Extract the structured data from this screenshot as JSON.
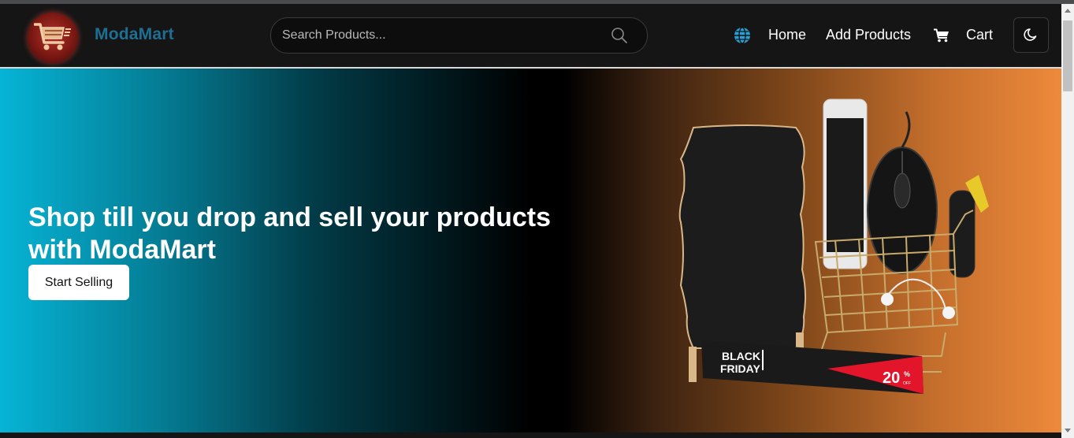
{
  "brand": {
    "name": "ModaMart",
    "logo_icon": "shopping-cart-logo-icon"
  },
  "search": {
    "placeholder": "Search Products...",
    "value": "",
    "icon": "search-icon"
  },
  "nav": {
    "globe_icon": "globe-icon",
    "links": [
      {
        "label": "Home"
      },
      {
        "label": "Add Products"
      },
      {
        "label": "Cart",
        "icon": "cart-icon"
      }
    ],
    "theme_toggle_icon": "moon-icon"
  },
  "hero": {
    "title": "Shop till you drop and sell your products with ModaMart",
    "cta_label": "Start Selling",
    "image": {
      "label_black_friday_line1": "BLACK",
      "label_black_friday_line2": "FRIDAY",
      "discount": "20",
      "discount_unit": "%",
      "discount_suffix": "OFF"
    }
  },
  "colors": {
    "brand_text": "#1e6f93",
    "navbar_bg": "#151515",
    "hero_left": "#06b4d6",
    "hero_right": "#ed893b"
  }
}
